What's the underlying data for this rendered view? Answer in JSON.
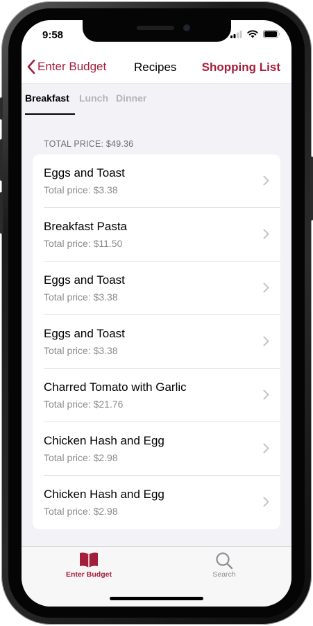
{
  "status_bar": {
    "time": "9:58"
  },
  "nav": {
    "back_label": "Enter Budget",
    "title": "Recipes",
    "right_label": "Shopping List"
  },
  "tabs": [
    {
      "label": "Breakfast",
      "active": true
    },
    {
      "label": "Lunch",
      "active": false
    },
    {
      "label": "Dinner",
      "active": false
    }
  ],
  "section": {
    "header": "TOTAL PRICE: $49.36"
  },
  "recipes": [
    {
      "title": "Eggs and Toast",
      "subtitle": "Total price: $3.38"
    },
    {
      "title": "Breakfast Pasta",
      "subtitle": "Total price: $11.50"
    },
    {
      "title": "Eggs and Toast",
      "subtitle": "Total price: $3.38"
    },
    {
      "title": "Eggs and Toast",
      "subtitle": "Total price: $3.38"
    },
    {
      "title": "Charred Tomato with Garlic",
      "subtitle": "Total price: $21.76"
    },
    {
      "title": "Chicken Hash and Egg",
      "subtitle": "Total price: $2.98"
    },
    {
      "title": "Chicken Hash and Egg",
      "subtitle": "Total price: $2.98"
    }
  ],
  "tabbar": {
    "items": [
      {
        "label": "Enter Budget",
        "icon": "book-icon",
        "active": true
      },
      {
        "label": "Search",
        "icon": "search-icon",
        "active": false
      }
    ]
  },
  "colors": {
    "accent": "#a41e3c",
    "inactive": "#8e8e93",
    "background": "#f2f2f7"
  }
}
